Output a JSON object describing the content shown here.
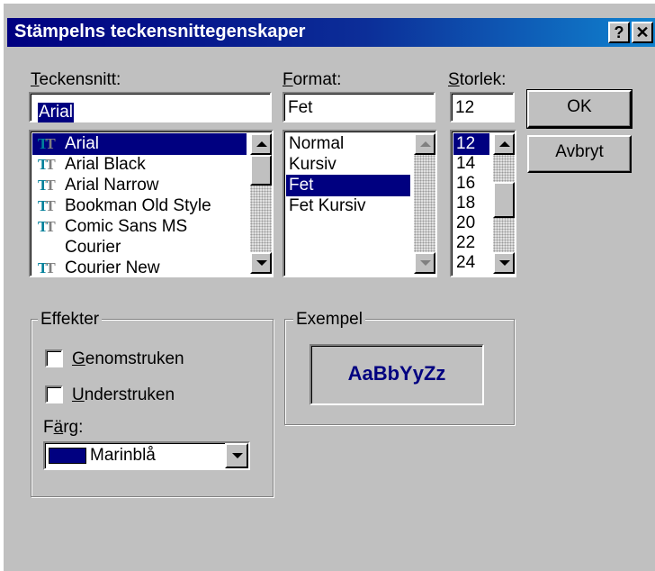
{
  "window": {
    "title": "Stämpelns teckensnittegenskaper",
    "help_label": "?",
    "close_label": "✕"
  },
  "font": {
    "label_u": "T",
    "label_rest": "eckensnitt:",
    "value": "Arial",
    "items": [
      {
        "name": "Arial",
        "truetype": true,
        "selected": true
      },
      {
        "name": "Arial Black",
        "truetype": true
      },
      {
        "name": "Arial Narrow",
        "truetype": true
      },
      {
        "name": "Bookman Old Style",
        "truetype": true
      },
      {
        "name": "Comic Sans MS",
        "truetype": true
      },
      {
        "name": "Courier",
        "truetype": false
      },
      {
        "name": "Courier New",
        "truetype": true
      }
    ]
  },
  "style": {
    "label_u": "F",
    "label_rest": "ormat:",
    "value": "Fet",
    "items": [
      "Normal",
      "Kursiv",
      "Fet",
      "Fet Kursiv"
    ],
    "selected_index": 2
  },
  "size": {
    "label_u": "S",
    "label_rest": "torlek:",
    "value": "12",
    "items": [
      "12",
      "14",
      "16",
      "18",
      "20",
      "22",
      "24"
    ],
    "selected_index": 0
  },
  "buttons": {
    "ok": "OK",
    "cancel": "Avbryt"
  },
  "effects": {
    "legend": "Effekter",
    "strike_u": "G",
    "strike_rest": "enomstruken",
    "underline_u": "U",
    "underline_rest": "nderstruken",
    "color_label_pre": "F",
    "color_label_u": "ä",
    "color_label_post": "rg:",
    "color_value": "Marinblå",
    "color_hex": "#000080"
  },
  "sample": {
    "legend": "Exempel",
    "text": "AaBbYyZz",
    "text_color": "#000080"
  },
  "icons": {
    "truetype": "truetype-font-icon",
    "dropdown": "chevron-down-icon"
  }
}
